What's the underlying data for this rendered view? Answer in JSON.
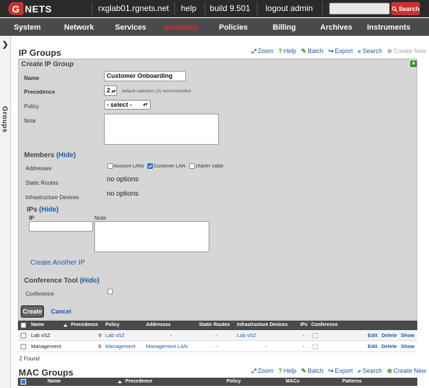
{
  "topbar": {
    "logo_letter": "G",
    "logo_text": "NETS",
    "host": "rxglab01.rgnets.net",
    "help": "help",
    "build": "build 9.501",
    "logout": "logout admin",
    "search_placeholder": "",
    "search_button": "Search"
  },
  "nav": {
    "items": [
      "System",
      "Network",
      "Services",
      "Identities",
      "Policies",
      "Billing",
      "Archives",
      "Instruments"
    ],
    "active": "Identities"
  },
  "rail": {
    "label": "Groups"
  },
  "ip_groups": {
    "title": "IP Groups",
    "toolbar": [
      "Zoom",
      "Help",
      "Batch",
      "Export",
      "Search",
      "Create New"
    ]
  },
  "form": {
    "header": "Create IP Group",
    "name_label": "Name",
    "name_value": "Customer Onboarding",
    "precedence_label": "Precedence",
    "precedence_value": "2",
    "precedence_hint": "default selection (2) recommended",
    "policy_label": "Policy",
    "policy_value": "- select -",
    "note_label": "Note",
    "members_title": "Members",
    "members_toggle": "(Hide)",
    "addresses_label": "Addresses",
    "address_options": [
      {
        "label": "Account LANs",
        "checked": false
      },
      {
        "label": "Customer LAN",
        "checked": true
      },
      {
        "label": "charter cable",
        "checked": false
      }
    ],
    "static_routes_label": "Static Routes",
    "static_routes_value": "no options",
    "infra_label": "Infrastructure Devices",
    "infra_value": "no options",
    "ips_title": "IPs",
    "ips_toggle": "(Hide)",
    "ip_col": "IP",
    "note_col": "Note",
    "create_another": "Create Another IP",
    "conference_title": "Conference Tool",
    "conference_toggle": "(Hide)",
    "conference_label": "Conference",
    "create_button": "Create",
    "cancel_link": "Cancel"
  },
  "ip_table": {
    "headers": [
      "Name",
      "Precedence",
      "Policy",
      "Addresses",
      "Static Routes",
      "Infrastructure Devices",
      "IPs",
      "Conference"
    ],
    "rows": [
      {
        "name": "Lab vSZ",
        "precedence": "9",
        "policy": "Lab vSZ",
        "addresses": "-",
        "static_routes": "-",
        "infra": "Lab vSZ",
        "ips": "-"
      },
      {
        "name": "Management",
        "precedence": "8",
        "policy": "Management",
        "addresses": "Management LAN",
        "static_routes": "-",
        "infra": "-",
        "ips": "-"
      }
    ],
    "actions": [
      "Edit",
      "Delete",
      "Show"
    ],
    "found": "2 Found"
  },
  "mac_groups": {
    "title": "MAC Groups",
    "toolbar": [
      "Zoom",
      "Help",
      "Batch",
      "Export",
      "Search",
      "Create New"
    ],
    "headers": [
      "Name",
      "Precedence",
      "Policy",
      "MACs",
      "Patterns"
    ]
  },
  "colors": {
    "accent": "#c9322e",
    "nav_active": "#e0252b",
    "link": "#1e5aa8",
    "panel": "#d6d6d6"
  }
}
